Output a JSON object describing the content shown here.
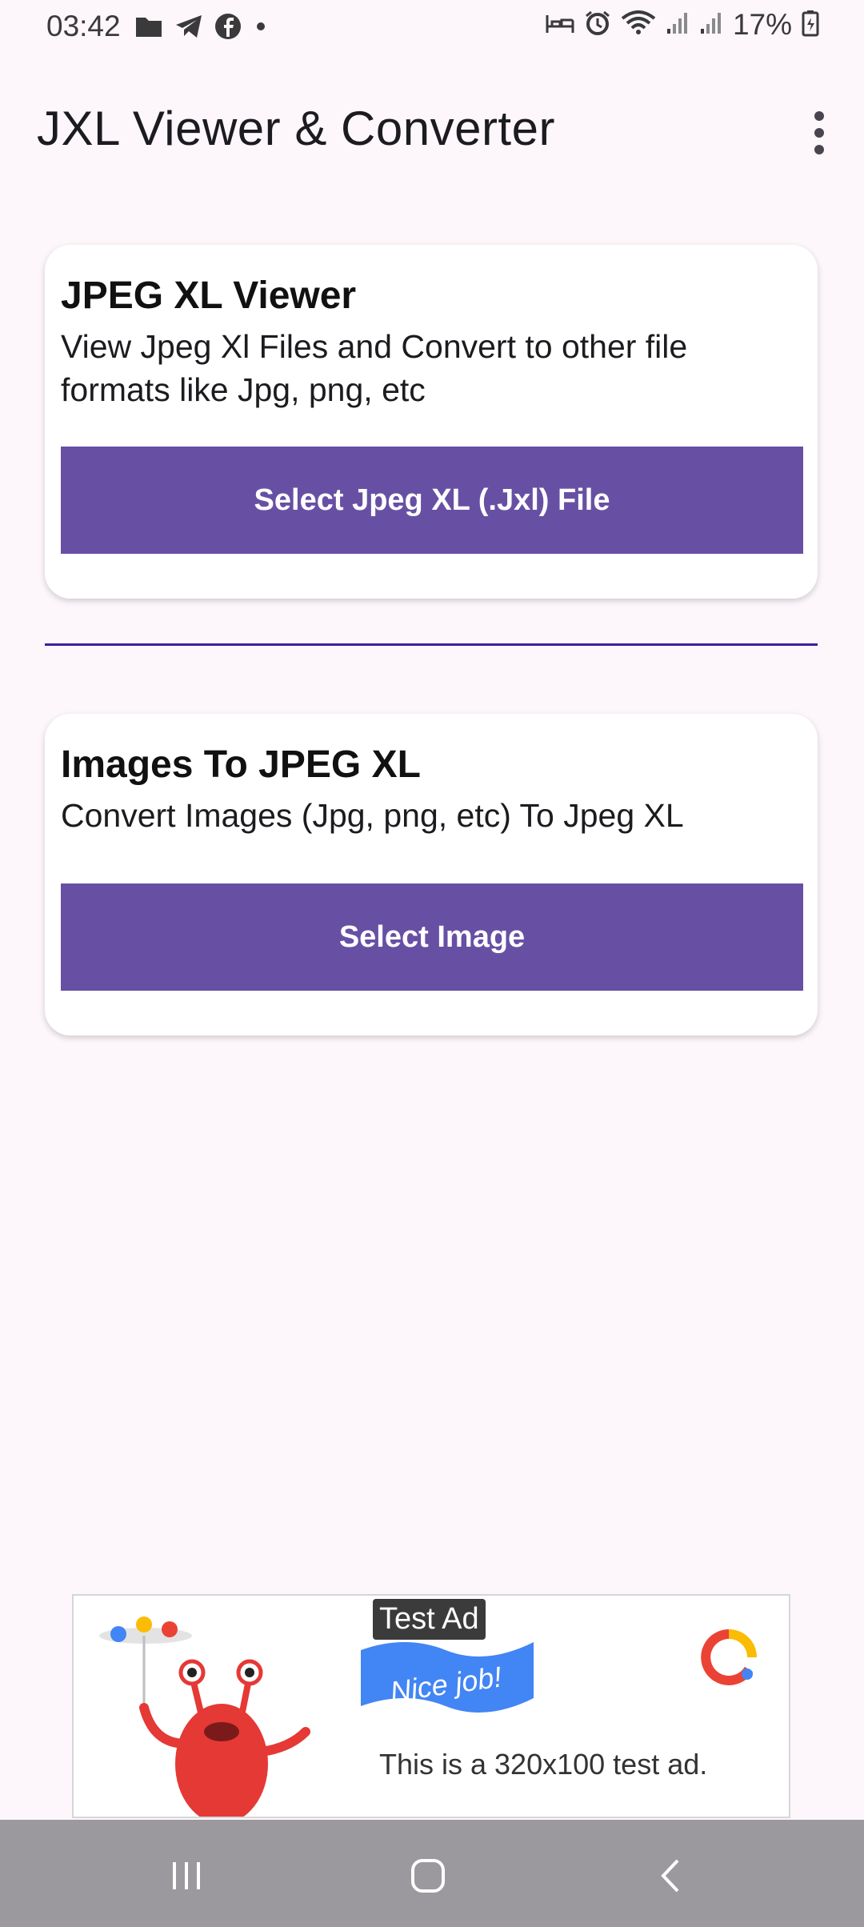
{
  "status_bar": {
    "time": "03:42",
    "battery_text": "17%",
    "icons_left": [
      "folder-icon",
      "telegram-icon",
      "facebook-icon",
      "dot-icon"
    ],
    "icons_right": [
      "bed-icon",
      "alarm-icon",
      "wifi-icon",
      "signal-icon",
      "signal-icon",
      "battery-icon"
    ]
  },
  "appbar": {
    "title": "JXL Viewer & Converter",
    "menu_icon": "more-vert-icon"
  },
  "cards": [
    {
      "title": "JPEG XL Viewer",
      "description": "View Jpeg Xl Files and Convert to other file formats like Jpg, png, etc",
      "button_label": "Select Jpeg XL (.Jxl) File"
    },
    {
      "title": "Images To JPEG XL",
      "description": "Convert Images (Jpg, png, etc) To Jpeg XL",
      "button_label": "Select Image"
    }
  ],
  "ad": {
    "label": "Test Ad",
    "flag_text": "Nice job!",
    "body_text": "This is a 320x100 test ad."
  },
  "navbar": {
    "buttons": [
      "recents-icon",
      "home-icon",
      "back-icon"
    ]
  },
  "colors": {
    "background": "#fdf7fc",
    "primary": "#6750a4",
    "divider": "#3b1fa0",
    "navbar": "#9c999e"
  }
}
